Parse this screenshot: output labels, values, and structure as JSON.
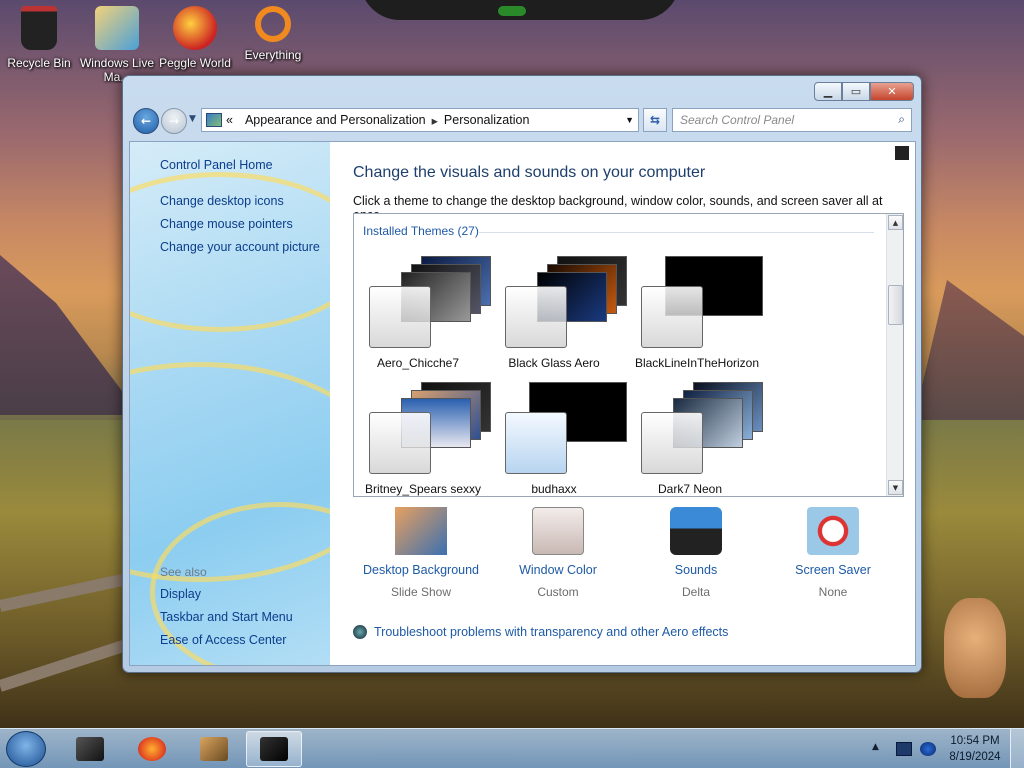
{
  "desktop": {
    "icons": [
      {
        "label": "Recycle Bin"
      },
      {
        "label": "Windows Live Ma..."
      },
      {
        "label": "Peggle World"
      },
      {
        "label": "Everything"
      }
    ]
  },
  "window": {
    "address": {
      "prefix": "«",
      "crumbs": [
        "Appearance and Personalization",
        "Personalization"
      ]
    },
    "search": {
      "placeholder": "Search Control Panel"
    },
    "left_pane": {
      "links": [
        "Control Panel Home",
        "Change desktop icons",
        "Change mouse pointers",
        "Change your account picture"
      ],
      "see_also_heading": "See also",
      "see_also_links": [
        "Display",
        "Taskbar and Start Menu",
        "Ease of Access Center"
      ]
    },
    "main": {
      "title": "Change the visuals and sounds on your computer",
      "subtitle": "Click a theme to change the desktop background, window color, sounds, and screen saver all at once.",
      "group_label": "Installed Themes (27)",
      "themes": [
        {
          "name": "Aero_Chicche7"
        },
        {
          "name": "Black Glass Aero"
        },
        {
          "name": "BlackLineInTheHorizon"
        },
        {
          "name": "Britney_Spears sexxy"
        },
        {
          "name": "budhaxx"
        },
        {
          "name": "Dark7 Neon"
        }
      ],
      "settings": [
        {
          "name": "Desktop Background",
          "value": "Slide Show"
        },
        {
          "name": "Window Color",
          "value": "Custom"
        },
        {
          "name": "Sounds",
          "value": "Delta"
        },
        {
          "name": "Screen Saver",
          "value": "None"
        }
      ],
      "troubleshoot": "Troubleshoot problems with transparency and other Aero effects"
    }
  },
  "taskbar": {
    "clock_time": "10:54 PM",
    "clock_date": "8/19/2024"
  },
  "colors": {
    "link": "#1e5aa6",
    "title": "#1e3f6e",
    "left_link": "#0b3d8c"
  }
}
